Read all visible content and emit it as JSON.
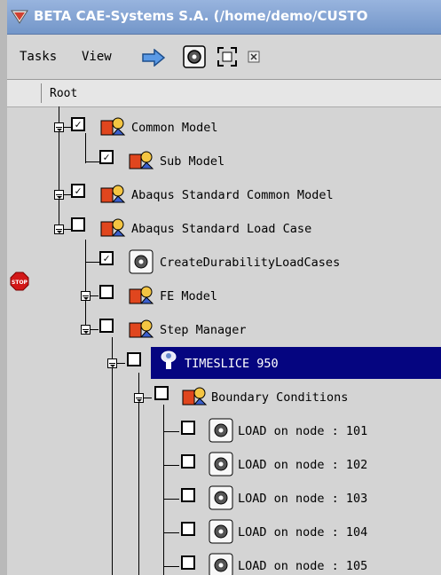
{
  "window": {
    "title": "BETA CAE-Systems S.A. (/home/demo/CUSTO"
  },
  "toolbar": {
    "menu_tasks": "Tasks",
    "menu_view": "View",
    "buttons": [
      "arrow-right-icon",
      "gear-icon",
      "fit-view-icon",
      "close-small-icon"
    ]
  },
  "tree": {
    "header": "Root",
    "nodes": [
      {
        "label": "Common Model",
        "checked": true,
        "icon": "model-icon"
      },
      {
        "label": "Sub Model",
        "checked": true,
        "icon": "model-icon"
      },
      {
        "label": "Abaqus Standard Common Model",
        "checked": true,
        "icon": "model-icon"
      },
      {
        "label": "Abaqus Standard Load Case",
        "checked": false,
        "icon": "model-icon"
      },
      {
        "label": "CreateDurabilityLoadCases",
        "checked": true,
        "icon": "gear-icon"
      },
      {
        "label": "FE Model",
        "checked": false,
        "icon": "model-icon"
      },
      {
        "label": "Step Manager",
        "checked": false,
        "icon": "model-icon"
      },
      {
        "label": "TIMESLICE 950",
        "checked": false,
        "icon": "timeslice-icon",
        "selected": true,
        "stop": true
      },
      {
        "label": "Boundary Conditions",
        "checked": false,
        "icon": "model-icon"
      },
      {
        "label": "LOAD on node : 101",
        "checked": false,
        "icon": "gear-icon"
      },
      {
        "label": "LOAD on node : 102",
        "checked": false,
        "icon": "gear-icon"
      },
      {
        "label": "LOAD on node : 103",
        "checked": false,
        "icon": "gear-icon"
      },
      {
        "label": "LOAD on node : 104",
        "checked": false,
        "icon": "gear-icon"
      },
      {
        "label": "LOAD on node : 105",
        "checked": false,
        "icon": "gear-icon"
      }
    ]
  },
  "stop_badge": "STOP",
  "colors": {
    "selection": "#050580",
    "titlebar": "#7396c9"
  }
}
